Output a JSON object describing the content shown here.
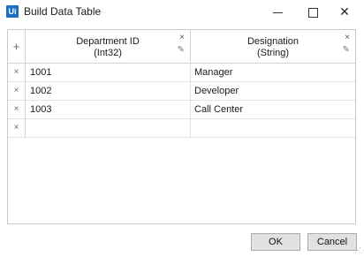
{
  "window": {
    "icon_text": "Ui",
    "title": "Build Data Table",
    "minimize_glyph": "",
    "maximize_glyph": "",
    "close_glyph": "✕"
  },
  "grid": {
    "add_glyph": "+",
    "remove_glyph": "×",
    "edit_glyph": "✎",
    "columns": [
      {
        "name": "Department ID",
        "type": "(Int32)"
      },
      {
        "name": "Designation",
        "type": "(String)"
      }
    ],
    "rows": [
      {
        "c1": "1001",
        "c2": "Manager"
      },
      {
        "c1": "1002",
        "c2": "Developer"
      },
      {
        "c1": "1003",
        "c2": "Call Center"
      },
      {
        "c1": "",
        "c2": ""
      }
    ]
  },
  "buttons": {
    "ok_label": "OK",
    "cancel_label": "Cancel"
  },
  "colors": {
    "accent": "#1b6ec2",
    "button_bg": "#e1e1e1",
    "grid_border": "#c9c9c9"
  }
}
